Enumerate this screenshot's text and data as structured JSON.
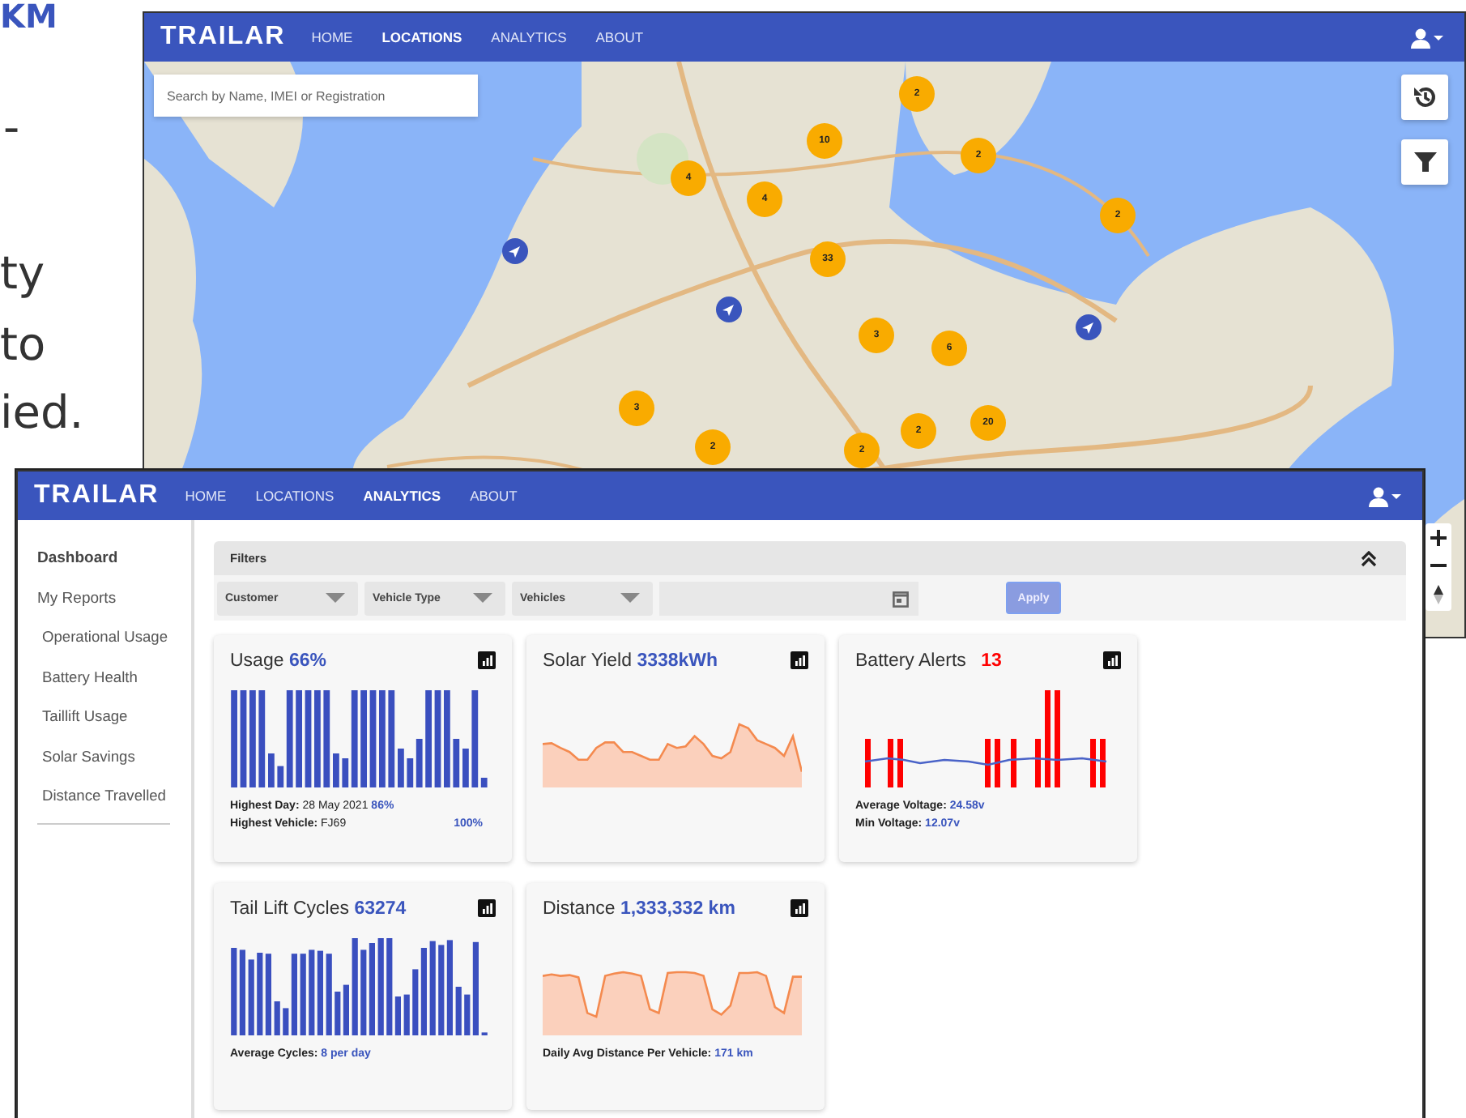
{
  "slide_text": [
    {
      "text": "KM",
      "kind": "heading"
    },
    {
      "text": "-",
      "kind": "body"
    },
    {
      "text": "ty",
      "kind": "body"
    },
    {
      "text": "to",
      "kind": "body"
    },
    {
      "text": "ied.",
      "kind": "body"
    }
  ],
  "map_window": {
    "nav": {
      "logo": "TRAILAR",
      "items": [
        {
          "label": "HOME",
          "selected": false
        },
        {
          "label": "LOCATIONS",
          "selected": true
        },
        {
          "label": "ANALYTICS",
          "selected": false
        },
        {
          "label": "ABOUT",
          "selected": false
        }
      ]
    },
    "search": {
      "placeholder": "Search by Name, IMEI or Registration"
    },
    "clusters": [
      {
        "count": "2"
      },
      {
        "count": "10"
      },
      {
        "count": "2"
      },
      {
        "count": "4"
      },
      {
        "count": "4"
      },
      {
        "count": "2"
      },
      {
        "count": "33"
      },
      {
        "count": "3"
      },
      {
        "count": "6"
      },
      {
        "count": "3"
      },
      {
        "count": "2"
      },
      {
        "count": "20"
      },
      {
        "count": "2"
      },
      {
        "count": "2"
      }
    ]
  },
  "analytics_window": {
    "nav": {
      "logo": "TRAILAR",
      "items": [
        {
          "label": "HOME",
          "selected": false
        },
        {
          "label": "LOCATIONS",
          "selected": false
        },
        {
          "label": "ANALYTICS",
          "selected": true
        },
        {
          "label": "ABOUT",
          "selected": false
        }
      ]
    },
    "sidebar": {
      "items": [
        {
          "label": "Dashboard",
          "selected": true
        },
        {
          "label": "My Reports",
          "selected": false,
          "children": [
            {
              "label": "Operational Usage",
              "selected": false
            },
            {
              "label": "Battery Health",
              "selected": false
            },
            {
              "label": "Taillift Usage",
              "selected": false
            },
            {
              "label": "Solar Savings",
              "selected": false
            },
            {
              "label": "Distance Travelled",
              "selected": false
            }
          ]
        }
      ]
    },
    "filters": {
      "title": "Filters",
      "expanded": true,
      "dropdowns": [
        {
          "label": "Customer"
        },
        {
          "label": "Vehicle Type"
        },
        {
          "label": "Vehicles"
        }
      ],
      "apply": {
        "label": "Apply",
        "disabled": true
      }
    },
    "cards": [
      {
        "title": "Usage",
        "value": "66%",
        "alert": false,
        "kind": "bars",
        "lines": [
          {
            "label": "Highest Day:",
            "text": "28 May 2021",
            "value": "86%",
            "kind": "inline"
          },
          {
            "label": "Highest Vehicle:",
            "text": "FJ69",
            "value": "100%",
            "kind": "right"
          }
        ]
      },
      {
        "title": "Solar Yield",
        "value": "3338kWh",
        "alert": false,
        "kind": "area"
      },
      {
        "title": "Battery Alerts",
        "value": "13",
        "alert": true,
        "kind": "alerts",
        "lines": [
          {
            "label": "Average Voltage:",
            "value": "24.58v",
            "kind": "inline"
          },
          {
            "label": "Min Voltage:",
            "value": "12.07v",
            "kind": "inline"
          }
        ]
      },
      {
        "title": "Tail Lift Cycles",
        "value": "63274",
        "alert": false,
        "kind": "bars",
        "lines": [
          {
            "label": "Average Cycles:",
            "value": "8 per day",
            "kind": "inline"
          }
        ]
      },
      {
        "title": "Distance",
        "value": "1,333,332 km",
        "alert": false,
        "kind": "area",
        "lines": [
          {
            "label": "Daily Avg Distance Per Vehicle:",
            "value": "171 km",
            "kind": "inline"
          }
        ]
      }
    ]
  }
}
